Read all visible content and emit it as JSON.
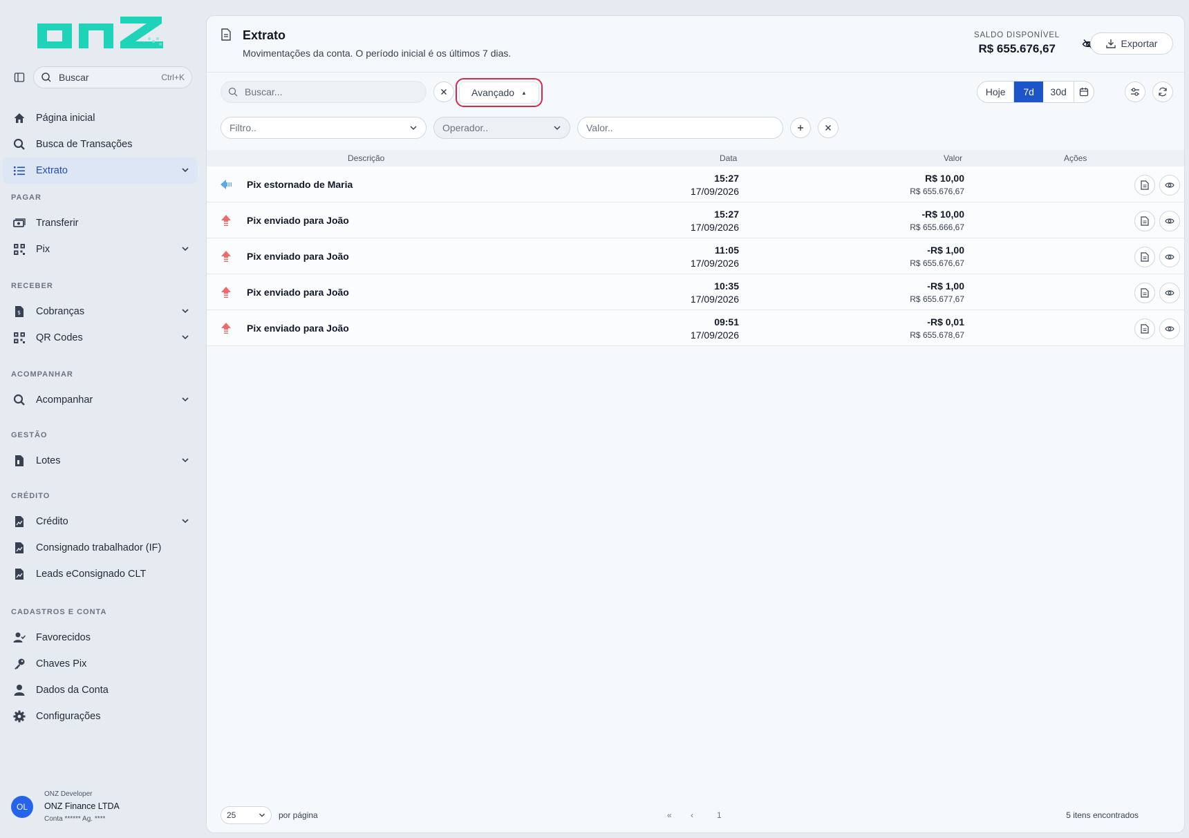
{
  "brand": {
    "logo_text": "onz",
    "color": "#1ed3b8"
  },
  "sidebar": {
    "toggle_icon": "sidebar-toggle-icon",
    "search": {
      "label": "Buscar",
      "shortcut": "Ctrl+K"
    },
    "items": [
      {
        "label": "Página inicial",
        "icon": "home-icon"
      },
      {
        "label": "Busca de Transações",
        "icon": "search-icon"
      },
      {
        "label": "Extrato",
        "icon": "list-icon"
      },
      {
        "label": "Transferir",
        "icon": "money-icon"
      },
      {
        "label": "Pix",
        "icon": "qr-icon"
      },
      {
        "label": "Cobranças",
        "icon": "invoice-icon"
      },
      {
        "label": "QR Codes",
        "icon": "qr-icon"
      },
      {
        "label": "Acompanhar",
        "icon": "search-icon"
      },
      {
        "label": "Lotes",
        "icon": "file-icon"
      },
      {
        "label": "Crédito",
        "icon": "chart-file-icon"
      },
      {
        "label": "Consignado trabalhador (IF)",
        "icon": "chart-file-icon"
      },
      {
        "label": "Leads eConsignado CLT",
        "icon": "chart-file-icon"
      },
      {
        "label": "Favorecidos",
        "icon": "user-check-icon"
      },
      {
        "label": "Chaves Pix",
        "icon": "key-icon"
      },
      {
        "label": "Dados da Conta",
        "icon": "user-icon"
      },
      {
        "label": "Configurações",
        "icon": "gear-icon"
      }
    ],
    "sections": [
      "PAGAR",
      "RECEBER",
      "ACOMPANHAR",
      "GESTÃO",
      "CRÉDITO",
      "CADASTROS E CONTA"
    ]
  },
  "profile": {
    "initials": "OL",
    "role": "ONZ Developer",
    "company": "ONZ Finance LTDA",
    "account": "Conta ****** Ag. ****"
  },
  "header": {
    "title": "Extrato",
    "subtitle": "Movimentações da conta. O período inicial é os últimos 7 dias.",
    "saldo_label": "SALDO DISPONÍVEL",
    "saldo_value": "R$ 655.676,67",
    "export_label": "Exportar"
  },
  "toolbar": {
    "search_placeholder": "Buscar...",
    "advanced_label": "Avançado",
    "periods": [
      "Hoje",
      "7d",
      "30d"
    ],
    "active_period": "7d",
    "accent": "#1b55c9",
    "highlight": "#d5294b"
  },
  "filters": {
    "filter_placeholder": "Filtro..",
    "operator_placeholder": "Operador..",
    "value_placeholder": "Valor.."
  },
  "table": {
    "columns": [
      "Descrição",
      "Data",
      "Valor",
      "Ações"
    ],
    "rows": [
      {
        "type": "in",
        "description": "Pix estornado de Maria",
        "time": "15:27",
        "date": "17/09/2026",
        "value": "R$ 10,00",
        "balance": "R$ 655.676,67"
      },
      {
        "type": "out",
        "description": "Pix enviado para João",
        "time": "15:27",
        "date": "17/09/2026",
        "value": "-R$ 10,00",
        "balance": "R$ 655.666,67"
      },
      {
        "type": "out",
        "description": "Pix enviado para João",
        "time": "11:05",
        "date": "17/09/2026",
        "value": "-R$ 1,00",
        "balance": "R$ 655.676,67"
      },
      {
        "type": "out",
        "description": "Pix enviado para João",
        "time": "10:35",
        "date": "17/09/2026",
        "value": "-R$ 1,00",
        "balance": "R$ 655.677,67"
      },
      {
        "type": "out",
        "description": "Pix enviado para João",
        "time": "09:51",
        "date": "17/09/2026",
        "value": "-R$ 0,01",
        "balance": "R$ 655.678,67"
      }
    ]
  },
  "footer": {
    "per_page": "25",
    "per_page_label": "por página",
    "first": "«",
    "prev": "‹",
    "page": "1",
    "found": "5 itens encontrados"
  }
}
